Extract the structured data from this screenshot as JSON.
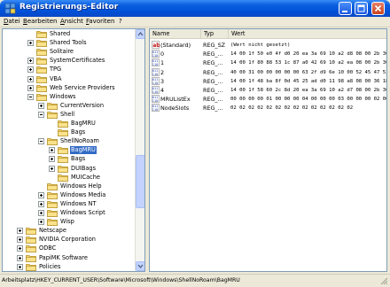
{
  "window": {
    "title": "Registrierungs-Editor",
    "icon": "regedit-icon"
  },
  "menu": [
    "Datei",
    "Bearbeiten",
    "Ansicht",
    "Favoriten",
    "?"
  ],
  "tree": [
    {
      "label": "Shared",
      "expander": "",
      "selected": false
    },
    {
      "label": "Shared Tools",
      "expander": "plus",
      "selected": false
    },
    {
      "label": "Solitaire",
      "expander": "",
      "selected": false
    },
    {
      "label": "SystemCertificates",
      "expander": "plus",
      "selected": false
    },
    {
      "label": "TPG",
      "expander": "plus",
      "selected": false
    },
    {
      "label": "VBA",
      "expander": "plus",
      "selected": false
    },
    {
      "label": "Web Service Providers",
      "expander": "plus",
      "selected": false
    },
    {
      "label": "Windows",
      "expander": "minus",
      "selected": false
    },
    {
      "label": "CurrentVersion",
      "expander": "plus",
      "selected": false
    },
    {
      "label": "Shell",
      "expander": "minus",
      "selected": false
    },
    {
      "label": "BagMRU",
      "expander": "",
      "selected": false
    },
    {
      "label": "Bags",
      "expander": "",
      "selected": false
    },
    {
      "label": "ShellNoRoam",
      "expander": "minus",
      "selected": false
    },
    {
      "label": "BagMRU",
      "expander": "plus",
      "selected": true
    },
    {
      "label": "Bags",
      "expander": "plus",
      "selected": false
    },
    {
      "label": "DUIBags",
      "expander": "plus",
      "selected": false
    },
    {
      "label": "MUICache",
      "expander": "",
      "selected": false
    },
    {
      "label": "Windows Help",
      "expander": "",
      "selected": false
    },
    {
      "label": "Windows Media",
      "expander": "plus",
      "selected": false
    },
    {
      "label": "Windows NT",
      "expander": "plus",
      "selected": false
    },
    {
      "label": "Windows Script",
      "expander": "plus",
      "selected": false
    },
    {
      "label": "Wisp",
      "expander": "plus",
      "selected": false
    },
    {
      "label": "Netscape",
      "expander": "plus",
      "selected": false
    },
    {
      "label": "NVIDIA Corporation",
      "expander": "plus",
      "selected": false
    },
    {
      "label": "ODBC",
      "expander": "plus",
      "selected": false
    },
    {
      "label": "PapiMK Software",
      "expander": "plus",
      "selected": false
    },
    {
      "label": "Policies",
      "expander": "plus",
      "selected": false
    }
  ],
  "list": {
    "columns": [
      "Name",
      "Typ",
      "Wert"
    ],
    "rows": [
      {
        "icon": "string-value-icon",
        "name": "(Standard)",
        "type": "REG_SZ",
        "data": "(Wert nicht gesetzt)"
      },
      {
        "icon": "binary-value-icon",
        "name": "0",
        "type": "REG_...",
        "data": "14 00 1f 50 e0 4f d0 20 ea 3a 69 10 a2 d8 08 00 2b 30 30 9d"
      },
      {
        "icon": "binary-value-icon",
        "name": "1",
        "type": "REG_...",
        "data": "14 00 1f 80 88 53 1c 87 a0 42 69 10 a2 ea 08 00 2b 30 30 9d"
      },
      {
        "icon": "binary-value-icon",
        "name": "2",
        "type": "REG_...",
        "data": "40 00 31 00 00 00 00 00 63 2f d9 6e 10 00 52 45 47 53 48 4f"
      },
      {
        "icon": "binary-value-icon",
        "name": "3",
        "type": "REG_...",
        "data": "14 00 1f 48 ba 8f 0d 45 25 ad d0 11 98 a8 08 00 36 1b 11 03"
      },
      {
        "icon": "binary-value-icon",
        "name": "4",
        "type": "REG_...",
        "data": "14 00 1f 58 60 2c 8d 20 ea 3a 69 10 a2 d7 08 00 2b 30 30 9d"
      },
      {
        "icon": "binary-value-icon",
        "name": "MRUListEx",
        "type": "REG_...",
        "data": "00 00 00 00 01 00 00 00 04 00 00 00 03 00 00 00 02 00 00 00"
      },
      {
        "icon": "binary-value-icon",
        "name": "NodeSlots",
        "type": "REG_...",
        "data": "02 02 02 02 02 02 02 02 02 02 02 02 02 02"
      }
    ]
  },
  "status": "Arbeitsplatz\\HKEY_CURRENT_USER\\Software\\Microsoft\\Windows\\ShellNoRoam\\BagMRU"
}
